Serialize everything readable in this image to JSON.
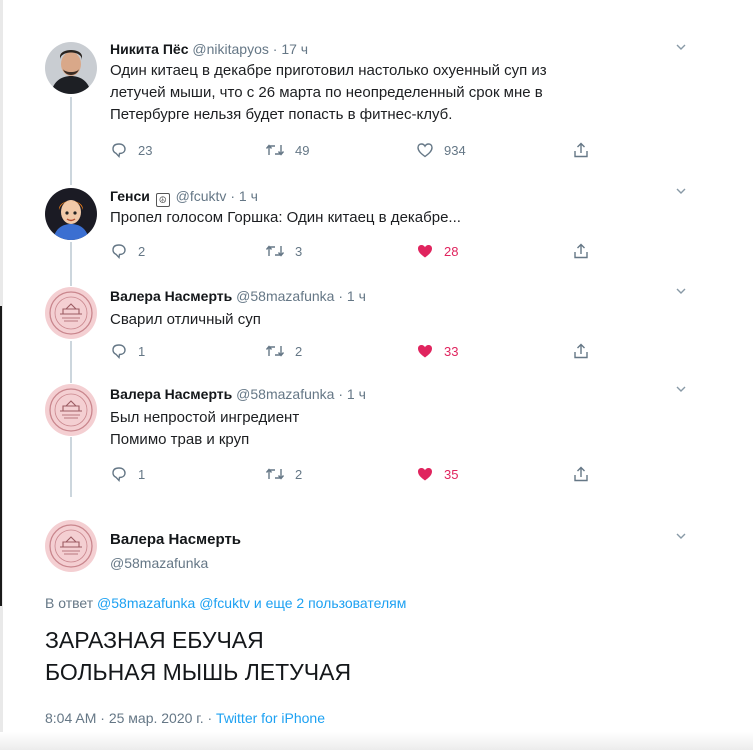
{
  "tweets": [
    {
      "name": "Никита Пёс",
      "handle": "@nikitapyos",
      "time": "17 ч",
      "lines": [
        "Один китаец в декабре приготовил настолько охуенный суп из",
        "летучей мыши, что с 26 марта по неопределенный срок мне в",
        "Петербурге нельзя будет попасть в фитнес-клуб."
      ],
      "replies": "23",
      "retweets": "49",
      "likes": "934",
      "liked": false
    },
    {
      "name": "Генси",
      "handle": "@fcuktv",
      "time": "1 ч",
      "lines": [
        "Пропел голосом Горшка: Один китаец в декабре..."
      ],
      "replies": "2",
      "retweets": "3",
      "likes": "28",
      "liked": true
    },
    {
      "name": "Валера Насмерть",
      "handle": "@58mazafunka",
      "time": "1 ч",
      "lines": [
        "Сварил отличный суп"
      ],
      "replies": "1",
      "retweets": "2",
      "likes": "33",
      "liked": true
    },
    {
      "name": "Валера Насмерть",
      "handle": "@58mazafunka",
      "time": "1 ч",
      "lines": [
        "Был непростой ингредиент",
        "Помимо трав и круп"
      ],
      "replies": "1",
      "retweets": "2",
      "likes": "35",
      "liked": true
    }
  ],
  "focus": {
    "name": "Валера Насмерть",
    "handle": "@58mazafunka",
    "reply_prefix": "В ответ",
    "reply_to_1": "@58mazafunka",
    "reply_to_2": "@fcuktv",
    "reply_to_more": "и еще 2 пользователям",
    "text_line_1": "ЗАРАЗНАЯ ЕБУЧАЯ",
    "text_line_2": "БОЛЬНАЯ МЫШЬ ЛЕТУЧАЯ",
    "time": "8:04 AM",
    "date": "25 мар. 2020 г.",
    "source": "Twitter for iPhone",
    "separator": "·"
  },
  "colors": {
    "like": "#e0245e",
    "link": "#1da1f2",
    "muted": "#657786",
    "thread": "#ccd6dd"
  },
  "icons": {
    "reply": "reply-icon",
    "retweet": "retweet-icon",
    "like": "heart-icon",
    "share": "share-icon",
    "menu": "chevron-down-icon"
  }
}
